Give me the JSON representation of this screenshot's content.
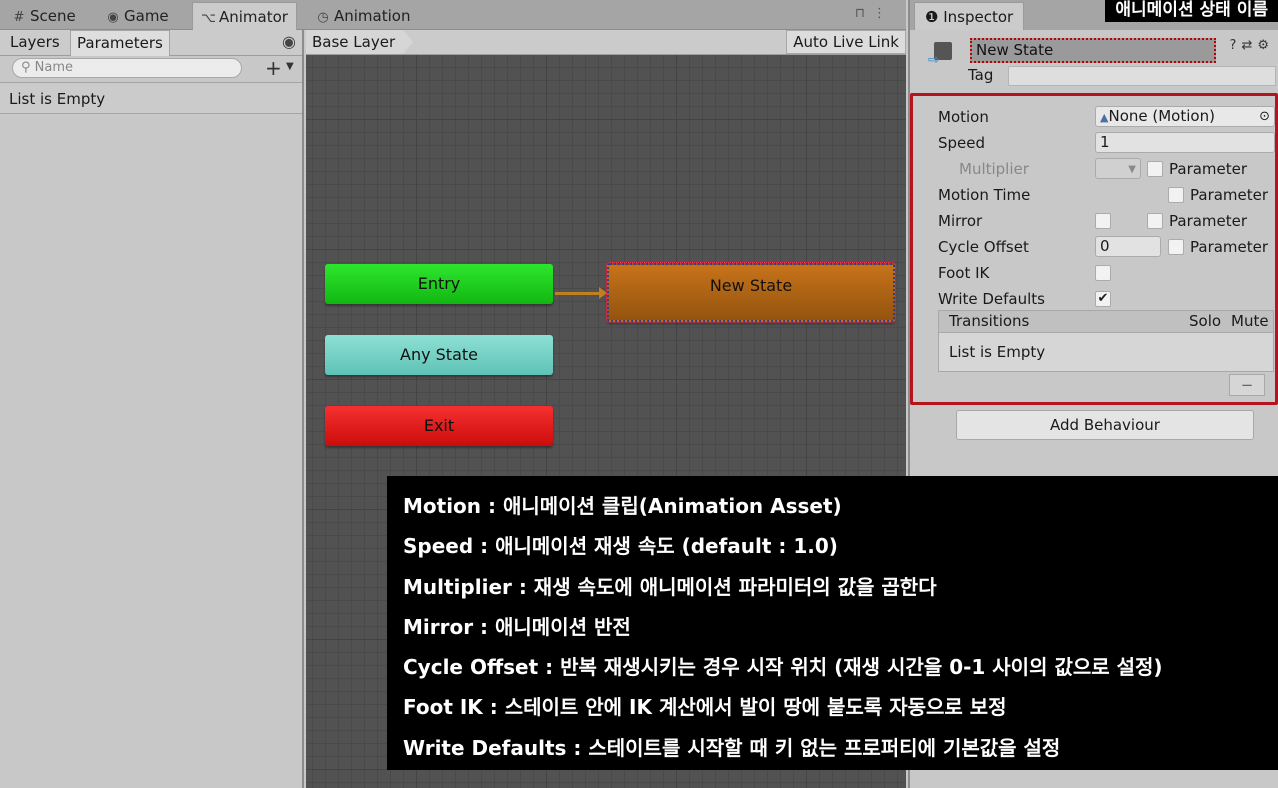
{
  "tabs": {
    "scene": "Scene",
    "game": "Game",
    "animator": "Animator",
    "animation": "Animation"
  },
  "left_panel": {
    "tab_layers": "Layers",
    "tab_parameters": "Parameters",
    "search_placeholder": "Name",
    "list_empty": "List is Empty"
  },
  "graph": {
    "breadcrumb": "Base Layer",
    "auto_live_link": "Auto Live Link",
    "nodes": {
      "entry": "Entry",
      "any_state": "Any State",
      "exit": "Exit",
      "new_state": "New State"
    }
  },
  "inspector": {
    "tab": "Inspector",
    "title_badge": "애니메이션 상태 이름",
    "name_value": "New State",
    "tag_label": "Tag",
    "tag_value": "",
    "motion_label": "Motion",
    "motion_value": "None (Motion)",
    "speed_label": "Speed",
    "speed_value": "1",
    "multiplier_label": "Multiplier",
    "motion_time_label": "Motion Time",
    "mirror_label": "Mirror",
    "cycle_offset_label": "Cycle Offset",
    "cycle_offset_value": "0",
    "foot_ik_label": "Foot IK",
    "write_defaults_label": "Write Defaults",
    "parameter_label": "Parameter",
    "transitions_label": "Transitions",
    "solo_label": "Solo",
    "mute_label": "Mute",
    "transitions_empty": "List is Empty",
    "minus": "−",
    "add_behaviour": "Add Behaviour",
    "write_defaults_checked": true
  },
  "overlay": {
    "lines": [
      "Motion : 애니메이션 클립(Animation Asset)",
      "Speed : 애니메이션 재생 속도 (default : 1.0)",
      "Multiplier : 재생 속도에 애니메이션 파라미터의 값을 곱한다",
      "Mirror : 애니메이션 반전",
      "Cycle Offset : 반복 재생시키는 경우 시작 위치 (재생 시간을 0-1 사이의 값으로 설정)",
      "Foot IK : 스테이트 안에 IK 계산에서 발이 땅에 붙도록 자동으로 보정",
      "Write Defaults : 스테이트를 시작할 때 키 없는 프로퍼티에 기본값을 설정"
    ]
  },
  "colors": {
    "entry": "#1ed21e",
    "any_state": "#79d2c7",
    "exit": "#e31a1a",
    "new_state": "#b06614",
    "highlight_border": "#b5141e"
  }
}
